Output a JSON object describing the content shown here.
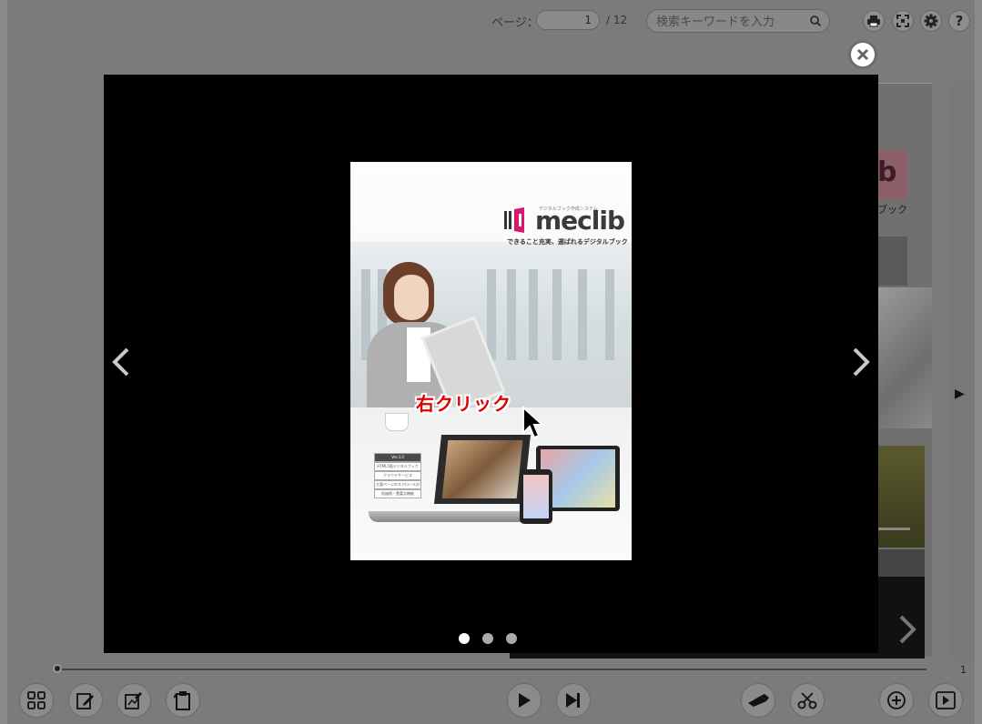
{
  "toolbar": {
    "page_label": "ページ：",
    "page_value": "1",
    "page_total": "/ 12",
    "search_placeholder": "検索キーワードを入力",
    "icons": [
      "print-icon",
      "fullscreen-icon",
      "gear-icon",
      "help-icon"
    ]
  },
  "background": {
    "logo_text": "b",
    "label": "ブック"
  },
  "modal": {
    "page": {
      "logo_text": "meclib",
      "logo_small": "デジタルブック作成システム",
      "tagline": "できること充実、選ばれるデジタルブック",
      "menu_items": [
        "Ver.3.0",
        "HTML5版デジタルブック",
        "クラウドサービス",
        "大量ページのスクロール対応",
        "低価格・豊富な機能"
      ],
      "annotation": "右クリック"
    },
    "dots": {
      "count": 3,
      "active": 0
    },
    "colors": {
      "annotation": "#e00000",
      "dot_active": "#ffffff",
      "dot_inactive": "#aaaaaa"
    }
  },
  "slider": {
    "value_label": "1"
  },
  "bottom_toolbar": {
    "left_buttons": [
      "thumbnail-icon",
      "bookmark-edit-icon",
      "note-edit-icon",
      "copy-page-icon"
    ],
    "center_buttons": [
      "play-icon",
      "skip-forward-icon"
    ],
    "right_buttons": [
      "highlighter-icon",
      "scissors-icon",
      "zoom-in-icon",
      "slideshow-icon"
    ]
  }
}
